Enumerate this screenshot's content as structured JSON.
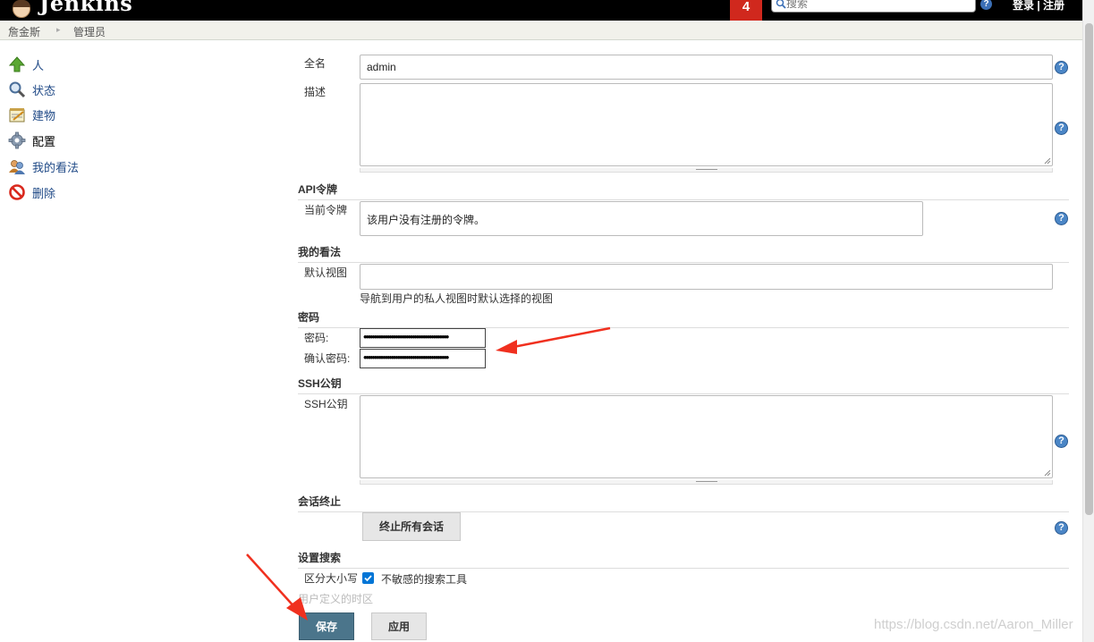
{
  "header": {
    "logo_text": "Jenkins",
    "badge_count": "4",
    "search_placeholder": "搜索",
    "help_glyph": "?",
    "login_label": "登录",
    "login_separator": " | ",
    "register_label": "注册",
    "background_color": "#000000",
    "badge_color": "#d0281d"
  },
  "breadcrumb": {
    "items": [
      "詹金斯",
      "管理员"
    ],
    "separator": "▸"
  },
  "sidebar": {
    "items": [
      {
        "label": "人",
        "icon": "up-arrow-icon"
      },
      {
        "label": "状态",
        "icon": "magnifier-icon"
      },
      {
        "label": "建物",
        "icon": "notepad-icon"
      },
      {
        "label": "配置",
        "icon": "gear-icon"
      },
      {
        "label": "我的看法",
        "icon": "people-icon"
      },
      {
        "label": "删除",
        "icon": "no-entry-icon"
      }
    ]
  },
  "form": {
    "fullname_label": "全名",
    "fullname_value": "admin",
    "description_label": "描述",
    "api_section": "API令牌",
    "current_token_label": "当前令牌",
    "current_token_text": "该用户没有注册的令牌。",
    "views_section": "我的看法",
    "default_view_label": "默认视图",
    "default_view_hint": "导航到用户的私人视图时默认选择的视图",
    "password_section": "密码",
    "password_label": "密码:",
    "password_value": "••••••••••••••••••••••••••••••••••••••••",
    "confirm_password_label": "确认密码:",
    "confirm_password_value": "••••••••••••••••••••••••••••••••••••••••",
    "ssh_section": "SSH公钥",
    "ssh_label": "SSH公钥",
    "session_section": "会话终止",
    "terminate_button": "终止所有会话",
    "search_section": "设置搜索",
    "case_label": "区分大小写",
    "case_checkbox_label": "不敏感的搜索工具",
    "case_checked": true,
    "timezone_label": "用户定义的时区",
    "help_glyph": "?"
  },
  "buttons": {
    "save": "保存",
    "apply": "应用",
    "save_color": "#4b758b"
  },
  "watermark": "https://blog.csdn.net/Aaron_Miller",
  "colors": {
    "link": "#204a87",
    "annotation_arrow": "#f0301f",
    "help_icon": "#4b86c6"
  }
}
